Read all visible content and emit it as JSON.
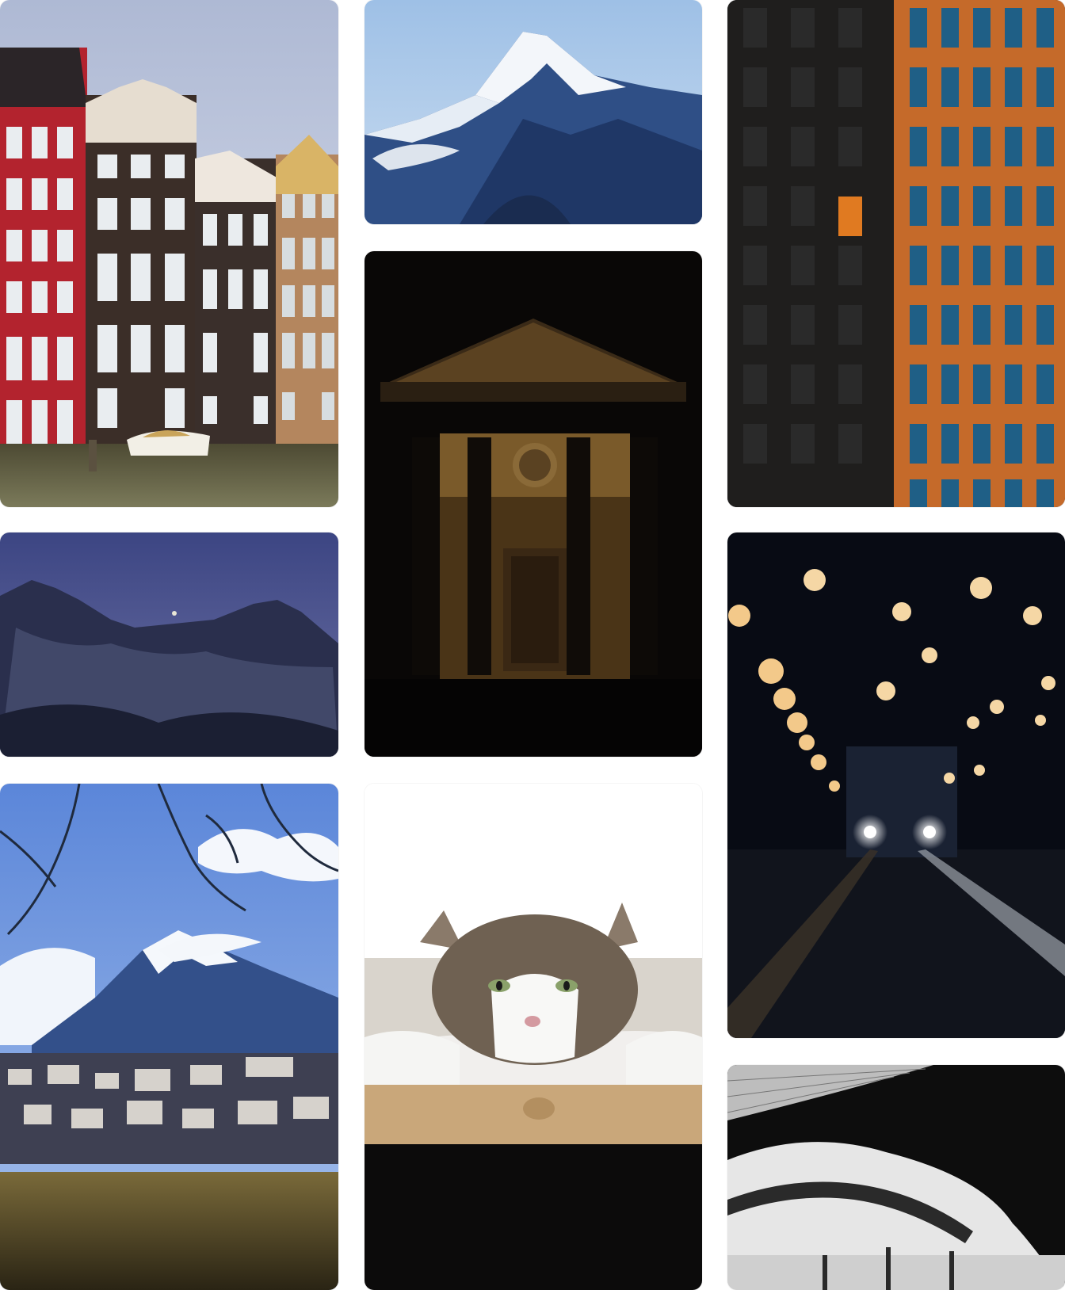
{
  "gallery": {
    "images": [
      {
        "name": "amsterdam-canal-houses",
        "scene": "canal-houses"
      },
      {
        "name": "snowy-mountain-peak",
        "scene": "mountain"
      },
      {
        "name": "orange-highrise-building",
        "scene": "building"
      },
      {
        "name": "dusk-mountain-ridge",
        "scene": "mountain-dusk"
      },
      {
        "name": "night-portico-building",
        "scene": "portico"
      },
      {
        "name": "christmas-lights-street",
        "scene": "street-night"
      },
      {
        "name": "mountain-town-branches",
        "scene": "town"
      },
      {
        "name": "cat-on-wooden-board",
        "scene": "cat"
      },
      {
        "name": "black-white-overpass",
        "scene": "overpass"
      }
    ]
  }
}
